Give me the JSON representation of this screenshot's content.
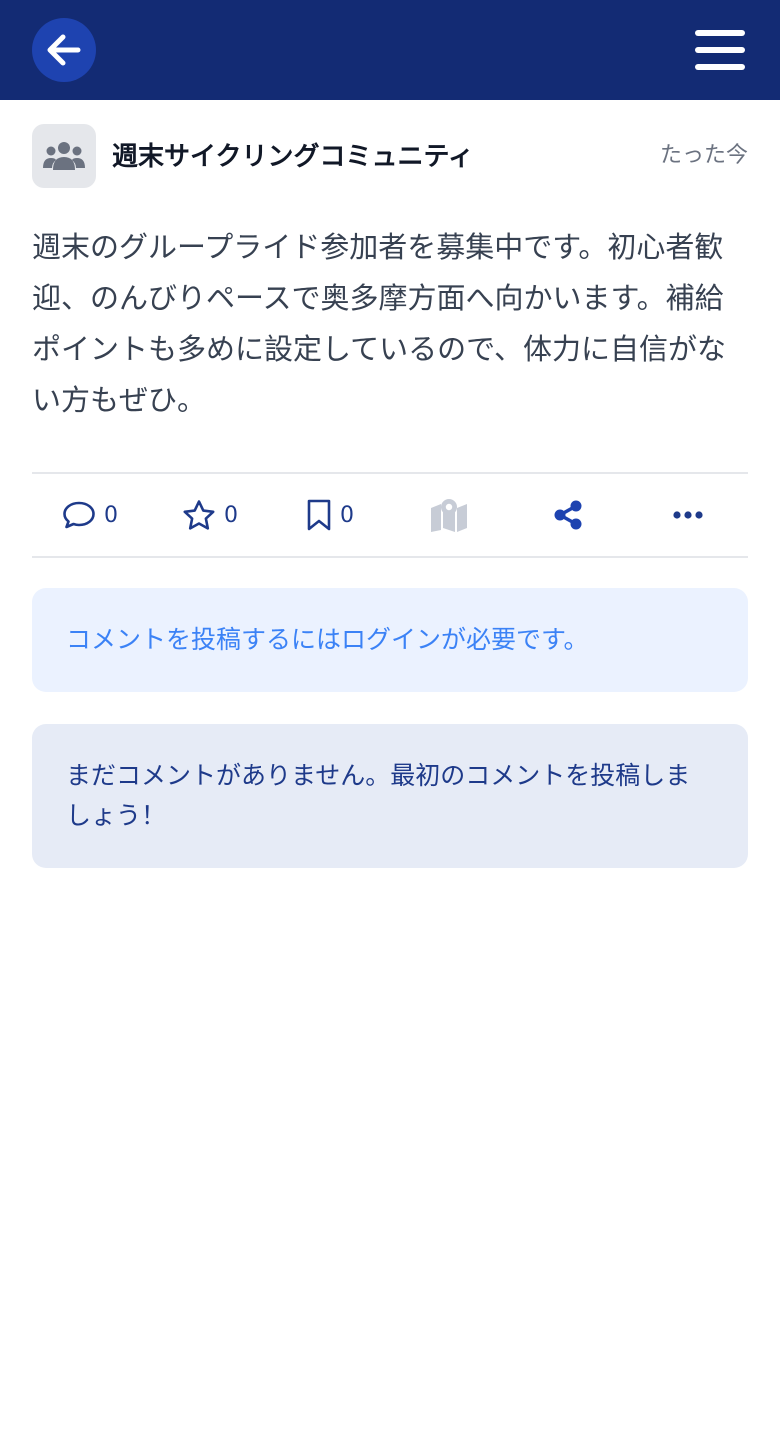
{
  "header": {
    "back_icon": "arrow-left-icon",
    "menu_icon": "hamburger-menu-icon",
    "background_color": "#132b74"
  },
  "post": {
    "community_icon": "group-icon",
    "community_name": "週末サイクリングコミュニティ",
    "timestamp": "たった今",
    "body": "週末のグループライド参加者を募集中です。初心者歓迎、のんびりペースで奥多摩方面へ向かいます。補給ポイントも多めに設定しているので、体力に自信がない方もぜひ。"
  },
  "actions": {
    "comments": {
      "icon": "comment-icon",
      "count": "0"
    },
    "favorites": {
      "icon": "star-icon",
      "count": "0"
    },
    "bookmarks": {
      "icon": "bookmark-icon",
      "count": "0"
    },
    "map": {
      "icon": "map-icon",
      "enabled": false
    },
    "share": {
      "icon": "share-icon"
    },
    "more": {
      "icon": "more-horizontal-icon"
    }
  },
  "comments": {
    "login_notice": "コメントを投稿するにはログインが必要です。",
    "empty_message": "まだコメントがありません。最初のコメントを投稿しましょう！"
  },
  "colors": {
    "accent": "#1e43b0",
    "action_icon": "#1e3a8a",
    "disabled_icon": "#c7ccd6",
    "login_text": "#3b82f6"
  }
}
